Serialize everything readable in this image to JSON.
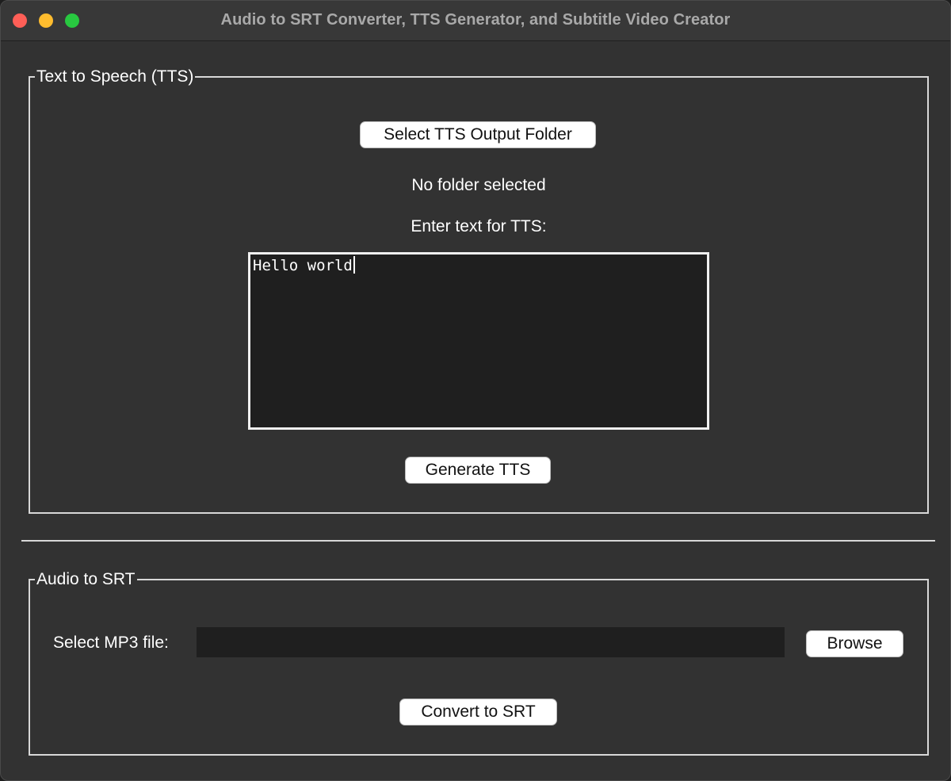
{
  "window": {
    "title": "Audio to SRT Converter, TTS Generator, and Subtitle Video Creator"
  },
  "tts": {
    "group_title": "Text to Speech (TTS)",
    "select_folder_label": "Select TTS Output Folder",
    "folder_status": "No folder selected",
    "prompt_label": "Enter text for TTS:",
    "text_value": "Hello world",
    "generate_label": "Generate TTS"
  },
  "srt": {
    "group_title": "Audio to SRT",
    "file_label": "Select MP3 file:",
    "file_value": "",
    "browse_label": "Browse",
    "convert_label": "Convert to SRT"
  },
  "colors": {
    "window_bg": "#323232",
    "titlebar_bg": "#383838",
    "border": "#d8d8d8",
    "close": "#ff5f57",
    "minimize": "#febc2e",
    "zoom": "#28c840"
  }
}
